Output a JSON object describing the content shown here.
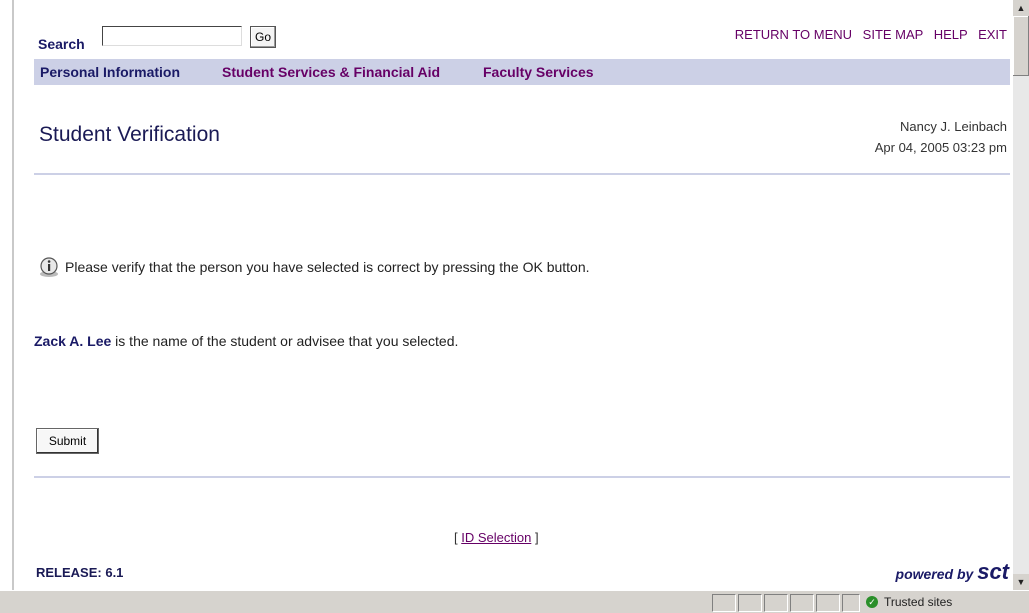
{
  "search": {
    "label": "Search",
    "value": "",
    "go_label": "Go"
  },
  "top_links": [
    "RETURN TO MENU",
    "SITE MAP",
    "HELP",
    "EXIT"
  ],
  "tabs": [
    "Personal Information",
    "Student Services & Financial Aid",
    "Faculty Services"
  ],
  "page": {
    "title": "Student Verification",
    "user": "Nancy J. Leinbach",
    "datetime": "Apr 04, 2005 03:23 pm"
  },
  "info_message": "Please verify that the person you have selected is correct by pressing the OK button.",
  "student": {
    "name": "Zack A. Lee",
    "text": " is the name of the student or advisee that you selected."
  },
  "submit_label": "Submit",
  "footer": {
    "bracket_open": "[ ",
    "link": "ID Selection",
    "bracket_close": " ]",
    "release": "RELEASE: 6.1",
    "powered_by": "powered by",
    "brand": "sct"
  },
  "status": {
    "zone": "Trusted sites"
  },
  "colors": {
    "accent": "#660066",
    "navy": "#1a1a66",
    "band": "#ccd0e6"
  }
}
